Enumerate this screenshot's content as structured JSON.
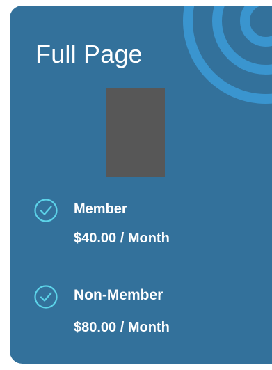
{
  "card": {
    "title": "Full Page",
    "image_placeholder_color": "#575757",
    "background_color": "#33719b",
    "accent_color": "#3aa0d8",
    "check_color": "#5cd3e9"
  },
  "plans": [
    {
      "name": "Member",
      "price": "$40.00 / Month",
      "icon": "check-circle-icon"
    },
    {
      "name": "Non-Member",
      "price": "$80.00 / Month",
      "icon": "check-circle-icon"
    }
  ]
}
